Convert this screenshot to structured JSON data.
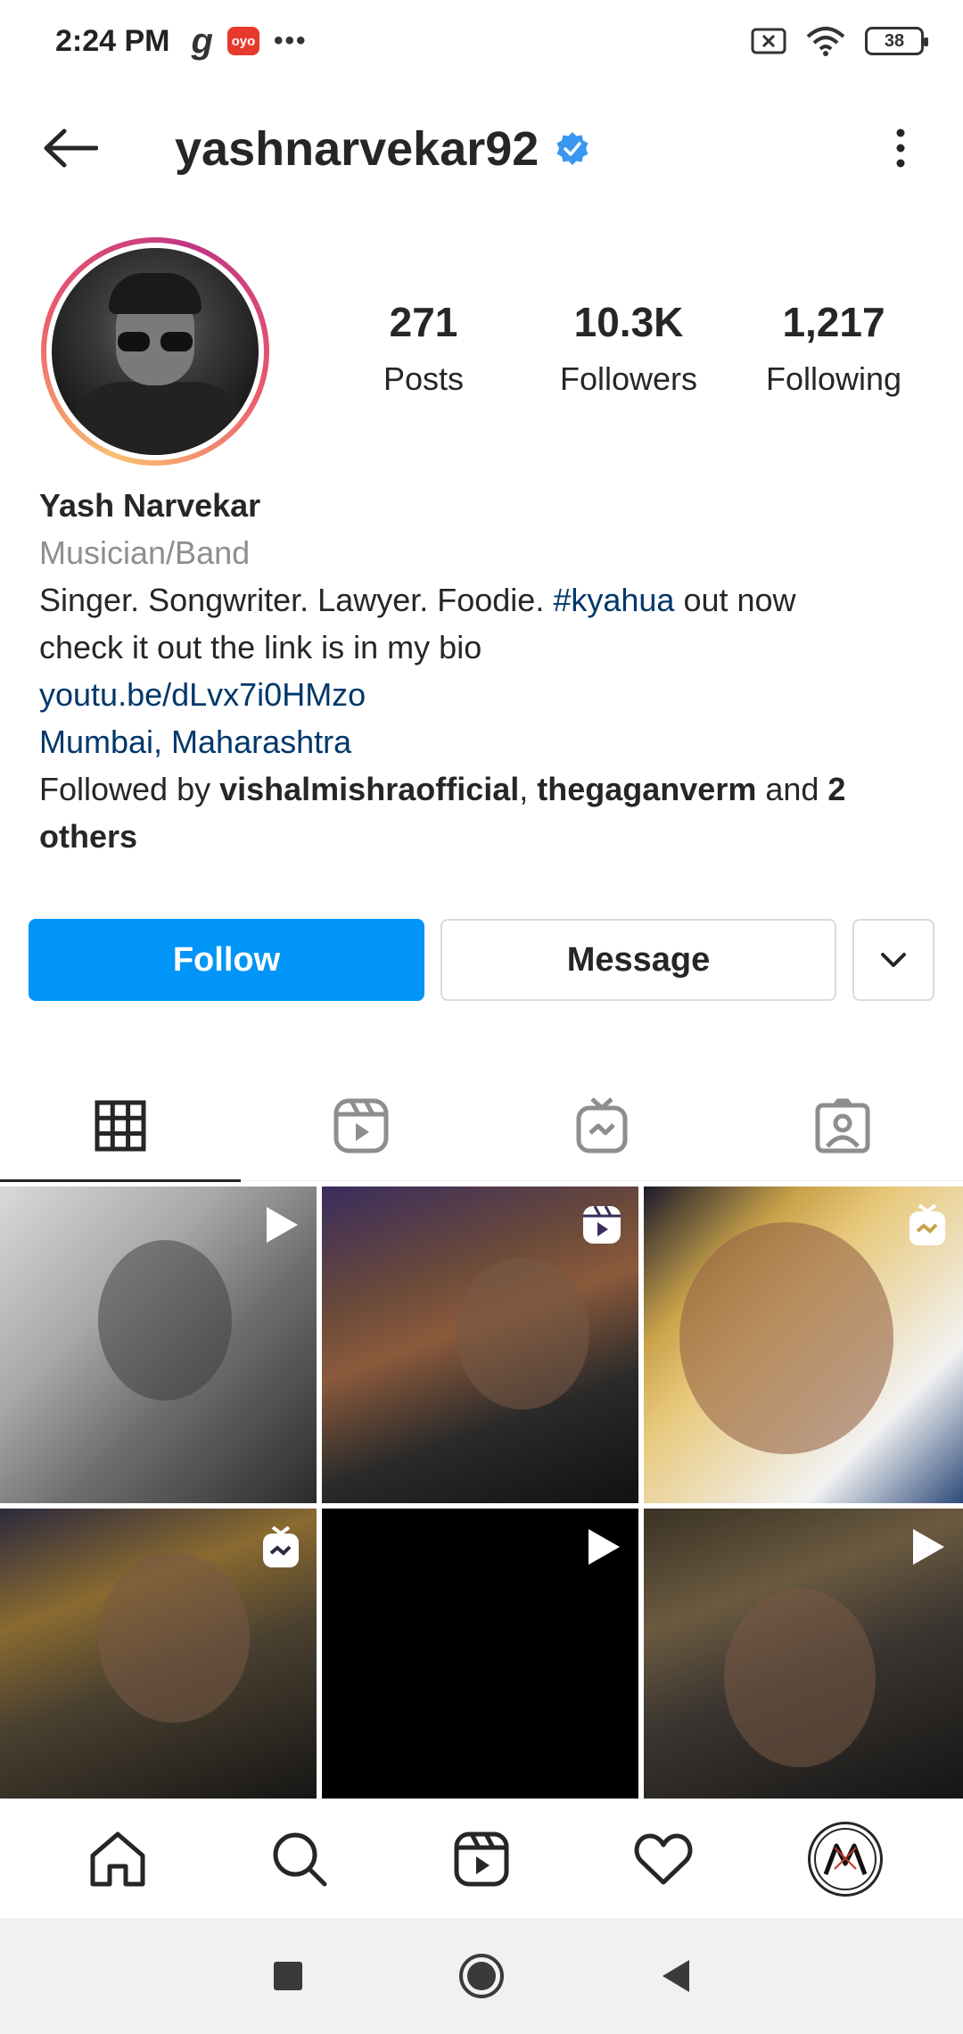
{
  "status_bar": {
    "time": "2:24 PM",
    "icons": [
      "g-app-icon",
      "oyo-icon",
      "more-dots-icon",
      "sim-icon",
      "wifi-icon",
      "battery-icon"
    ],
    "oyo_label": "oyo",
    "g_label": "g",
    "dots": "•••",
    "battery": "38"
  },
  "header": {
    "username": "yashnarvekar92",
    "verified": true
  },
  "profile": {
    "stats": [
      {
        "value": "271",
        "label": "Posts"
      },
      {
        "value": "10.3K",
        "label": "Followers"
      },
      {
        "value": "1,217",
        "label": "Following"
      }
    ],
    "name": "Yash Narvekar",
    "category": "Musician/Band",
    "bio_line1_pre": "Singer. Songwriter. Lawyer. Foodie. ",
    "bio_hashtag": "#kyahua",
    "bio_line1_post": " out now",
    "bio_line2": "check it out the link is in my bio",
    "link": "youtu.be/dLvx7i0HMzo",
    "location": "Mumbai, Maharashtra",
    "followed_by_prefix": "Followed by ",
    "followed_by_user1": "vishalmishraofficial",
    "followed_by_sep": ", ",
    "followed_by_user2": "thegaganverm",
    "followed_by_and": " and ",
    "followed_by_others": "2 others"
  },
  "actions": {
    "follow": "Follow",
    "message": "Message"
  },
  "tabs": [
    "grid",
    "reels",
    "igtv",
    "tagged"
  ],
  "accent_color": "#0095f6",
  "link_color": "#00376b"
}
